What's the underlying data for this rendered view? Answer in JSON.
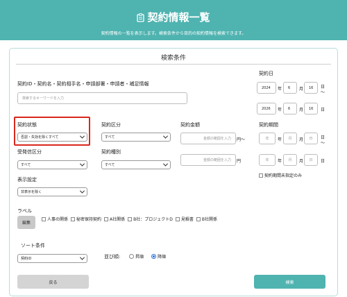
{
  "header": {
    "title": "契約情報一覧",
    "subtitle": "契約情報の一覧を表示します。検索条件から目的の契約情報を検索できます。"
  },
  "search": {
    "section_title": "検索条件",
    "keyword_label": "契約ID・契約名・契約相手名・申請部署・申請者・補足情報",
    "keyword_placeholder": "検索するキーワードを入力",
    "contract_date_label": "契約日",
    "date_from": {
      "year": "2024",
      "month": "6",
      "day": "16"
    },
    "date_to": {
      "year": "2026",
      "month": "6",
      "day": "16"
    },
    "unit_year": "年",
    "unit_month": "月",
    "unit_day": "日",
    "range_sep": "〜",
    "status_label": "契約状態",
    "status_value": "否認・失効を除くすべて",
    "category_label": "契約区分",
    "category_value": "すべて",
    "amount_label": "契約金額",
    "amount_placeholder": "金額の範囲を入力",
    "amount_unit": "円",
    "amount_sep": "〜",
    "period_label": "契約期間",
    "period_year_ph": "年",
    "period_month_ph": "月",
    "period_day_ph": "日",
    "send_label": "受発信区分",
    "send_value": "すべて",
    "type_label": "契約種別",
    "type_value": "すべて",
    "period_unset_label": "契約期間未指定のみ",
    "display_label": "表示設定",
    "display_value": "非表示を除く",
    "label_label": "ラベル",
    "edit_button": "編集",
    "labels": [
      "人事の関係",
      "秘密保持契約",
      "A社関係",
      "B社：プロジェクトD",
      "見積書",
      "B社関係"
    ],
    "sort_label": "ソート条件",
    "sort_value": "契約ID",
    "order_label": "並び順:",
    "order_asc": "昇順",
    "order_desc": "降順",
    "back_button": "戻る",
    "search_button": "検索"
  }
}
